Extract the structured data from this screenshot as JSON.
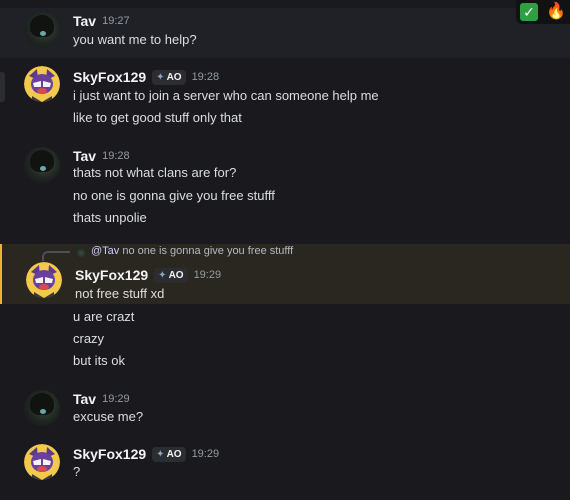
{
  "reactions": {
    "check": "✓",
    "fire": "🔥"
  },
  "messages": [
    {
      "username": "Tav",
      "time": "19:27",
      "lines": [
        "you want me to help?"
      ]
    },
    {
      "username": "SkyFox129",
      "tag": "AO",
      "time": "19:28",
      "lines": [
        "i just want to join a server who can someone help me",
        "like to get good stuff only that"
      ]
    },
    {
      "username": "Tav",
      "time": "19:28",
      "lines": [
        "thats not what clans are for?",
        "no one is gonna give you free stufff",
        "thats unpolie"
      ]
    },
    {
      "reply": {
        "mention": "@Tav",
        "text": "no one is gonna give you free stufff"
      },
      "username": "SkyFox129",
      "tag": "AO",
      "time": "19:29",
      "lines": [
        "not free stuff xd",
        "u are crazt",
        "crazy",
        "but its ok"
      ]
    },
    {
      "username": "Tav",
      "time": "19:29",
      "lines": [
        "excuse me?"
      ]
    },
    {
      "username": "SkyFox129",
      "tag": "AO",
      "time": "19:29",
      "lines": [
        "?"
      ]
    }
  ],
  "colors": {
    "background": "#1a1a1e",
    "mention_bar": "#f0b232",
    "username": "#f2f3f5",
    "text": "#dbdee1",
    "timestamp": "#949ba4"
  }
}
